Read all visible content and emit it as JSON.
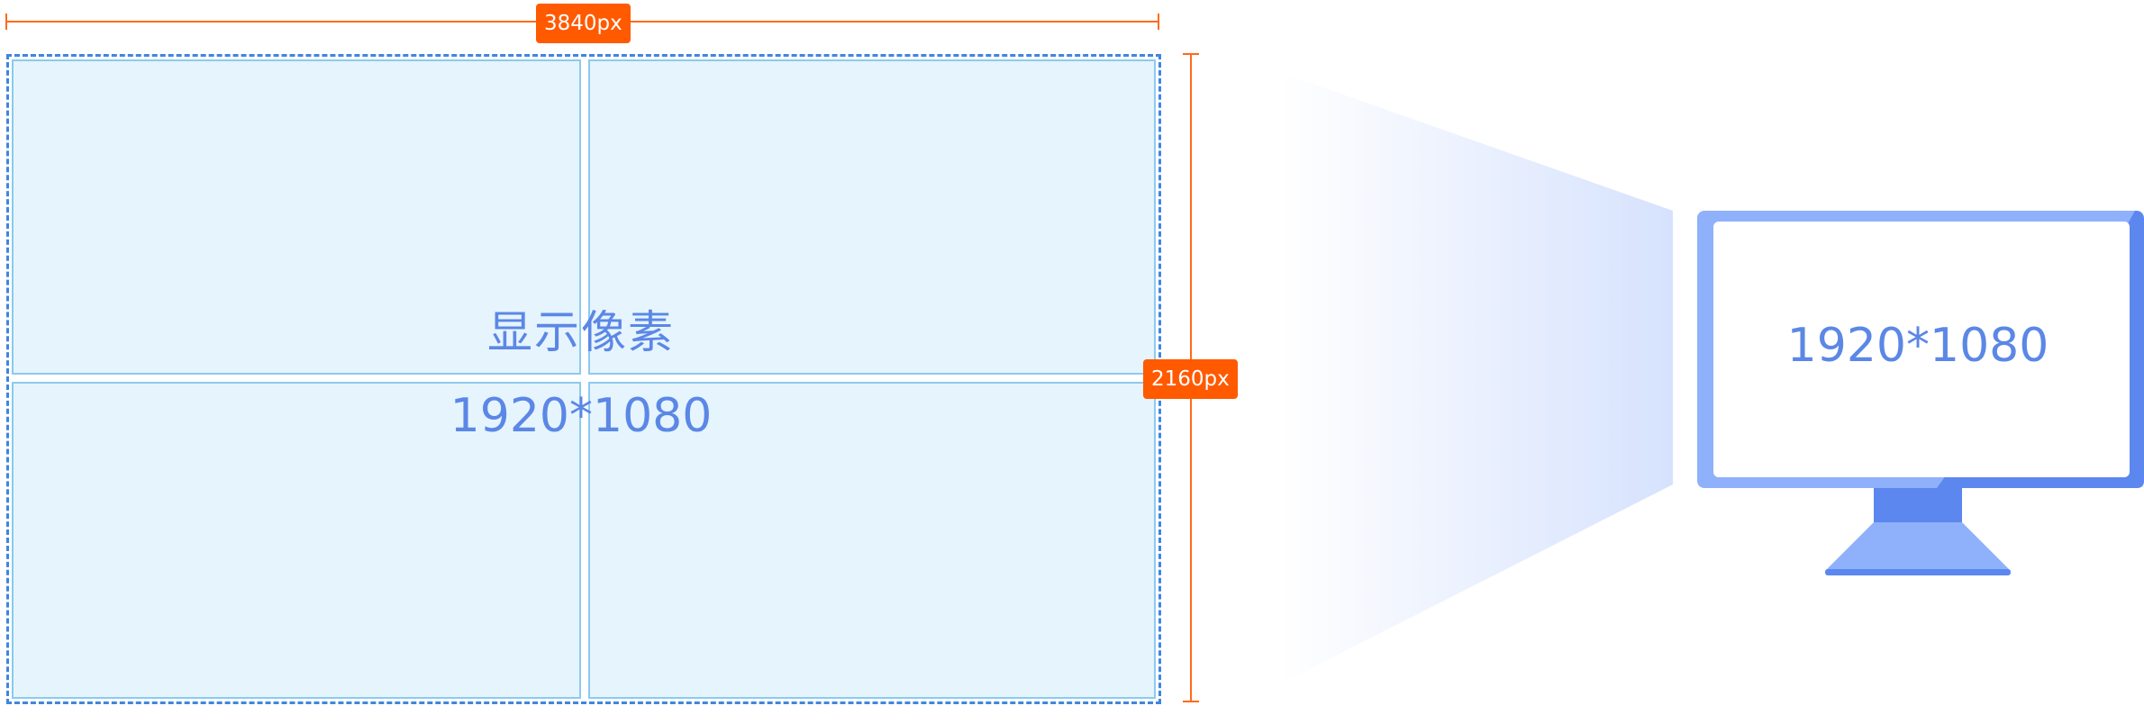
{
  "dimensions": {
    "width_label": "3840px",
    "height_label": "2160px"
  },
  "grid": {
    "title": "显示像素",
    "resolution": "1920*1080"
  },
  "monitor": {
    "resolution": "1920*1080"
  },
  "colors": {
    "dimension_accent": "#ff5a00",
    "grid_border": "#3f86e0",
    "cell_fill": "#e6f4fd",
    "text_blue": "#5b87e6",
    "monitor_frame": "#8fb0fb",
    "monitor_dark": "#5b87ef"
  }
}
